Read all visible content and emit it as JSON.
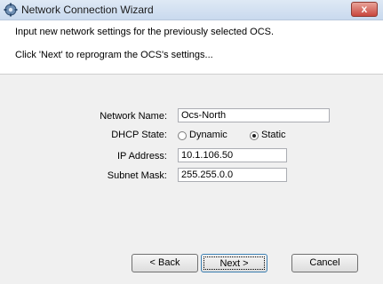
{
  "window": {
    "title": "Network Connection Wizard",
    "close_glyph": "x",
    "icon": "network-wizard-icon"
  },
  "header": {
    "instruction": "Input new network settings for the previously selected OCS.",
    "hint": "Click 'Next' to reprogram the OCS's settings..."
  },
  "form": {
    "network_name": {
      "label": "Network Name:",
      "value": "Ocs-North"
    },
    "dhcp_state": {
      "label": "DHCP State:",
      "options": [
        "Dynamic",
        "Static"
      ],
      "selected": "Static"
    },
    "ip_address": {
      "label": "IP Address:",
      "value": "10.1.106.50"
    },
    "subnet_mask": {
      "label": "Subnet Mask:",
      "value": "255.255.0.0"
    }
  },
  "buttons": {
    "back": "< Back",
    "next": "Next >",
    "cancel": "Cancel"
  },
  "colors": {
    "titlebar": "#c9d9ee",
    "close_button": "#c9463d",
    "dialog_background": "#f0f0f0"
  }
}
